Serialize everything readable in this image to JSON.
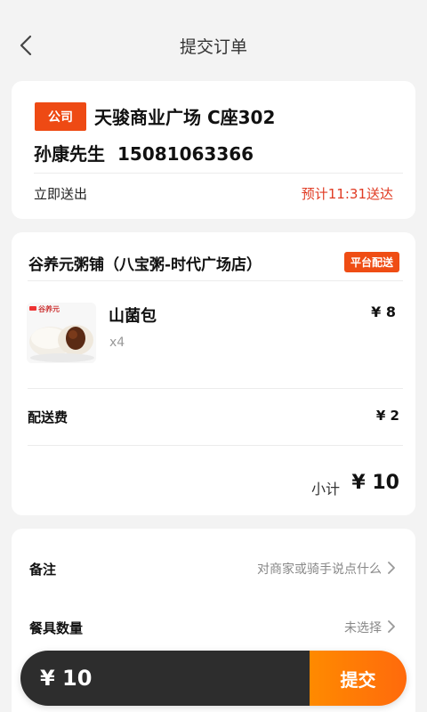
{
  "header": {
    "title": "提交订单"
  },
  "address": {
    "tag": "公司",
    "location": "天骏商业广场 C座302",
    "contact_name": "孙康先生",
    "phone": "15081063366",
    "delivery_mode": "立即送出",
    "eta": "预计11:31送达"
  },
  "order": {
    "shop_name": "谷养元粥铺（八宝粥-时代广场店）",
    "badge": "平台配送",
    "items": [
      {
        "name": "山菌包",
        "qty": "x4",
        "price": "¥ 8",
        "image_label": "谷养元"
      }
    ],
    "delivery_fee_label": "配送费",
    "delivery_fee": "¥ 2",
    "subtotal_label": "小计",
    "subtotal": "¥ 10"
  },
  "extras": {
    "note_label": "备注",
    "note_placeholder": "对商家或骑手说点什么",
    "utensils_label": "餐具数量",
    "utensils_value": "未选择"
  },
  "footer": {
    "total": "¥ 10",
    "submit_label": "提交"
  },
  "colors": {
    "accent": "#ee4a14",
    "eta_text": "#e03a22",
    "submit_start": "#ff8a00",
    "submit_end": "#ff6a0c",
    "pay_bar": "#2d2d2d"
  }
}
